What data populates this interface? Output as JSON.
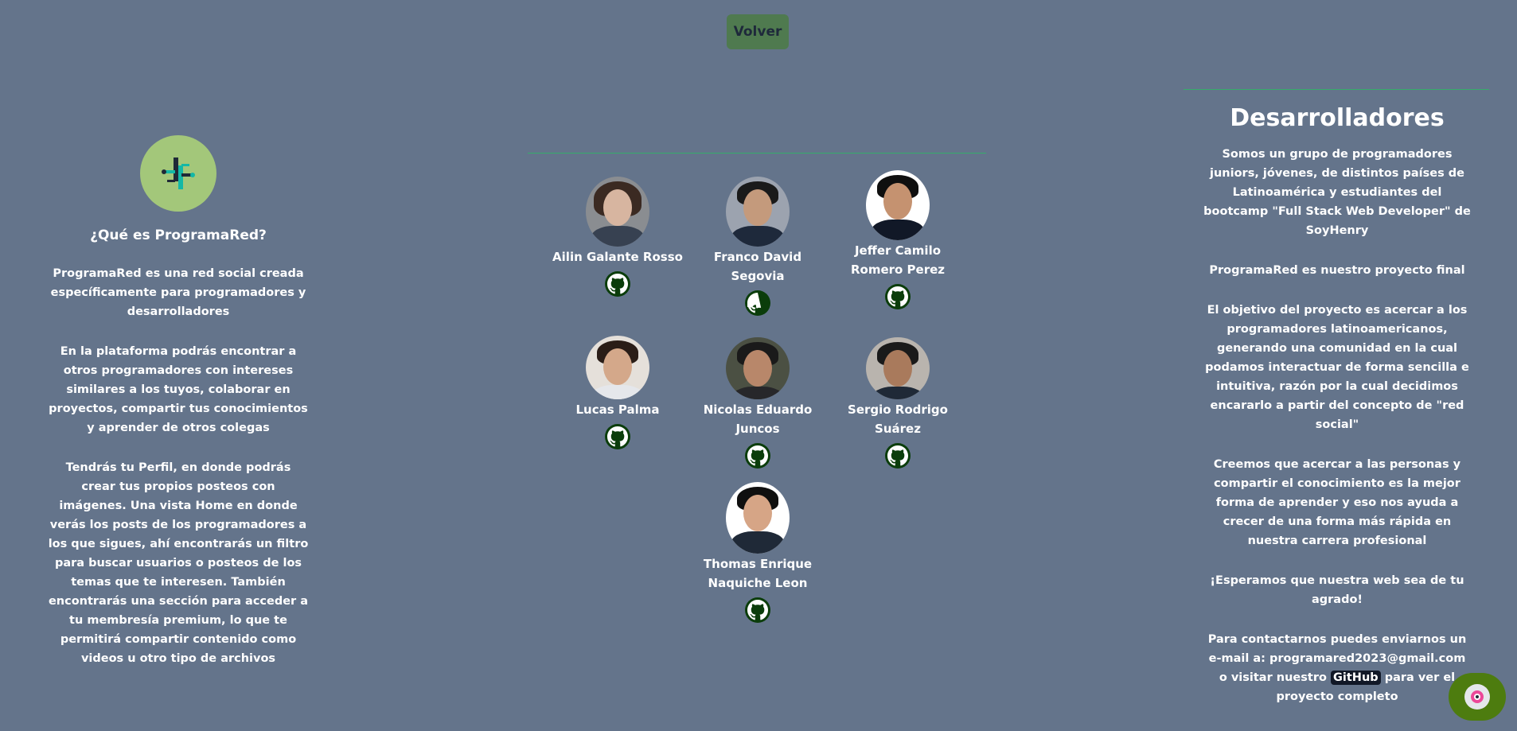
{
  "nav": {
    "back_label": "Volver"
  },
  "about": {
    "title": "¿Qué es ProgramaRed?",
    "paragraphs": [
      "ProgramaRed es una red social creada específicamente para programadores y desarrolladores",
      "En la plataforma podrás encontrar a otros programadores con intereses similares a los tuyos, colaborar en proyectos, compartir tus conocimientos y aprender de otros colegas",
      "Tendrás tu Perfil, en donde podrás crear tus propios posteos con imágenes. Una vista Home en donde verás los posts de los programadores a los que sigues, ahí encontrarás un filtro para buscar usuarios o posteos de los temas que te interesen. También encontrarás una sección para acceder a tu membresía premium, lo que te permitirá compartir contenido como videos u otro tipo de archivos"
    ]
  },
  "developers": [
    {
      "name": "Ailin Galante Rosso",
      "icon": "github-icon"
    },
    {
      "name": "Franco David Segovia",
      "icon": "github-icon"
    },
    {
      "name": "Jeffer Camilo Romero Perez",
      "icon": "github-icon"
    },
    {
      "name": "Lucas Palma",
      "icon": "github-icon"
    },
    {
      "name": "Nicolas Eduardo Juncos",
      "icon": "github-icon"
    },
    {
      "name": "Sergio Rodrigo Suárez",
      "icon": "github-icon"
    },
    {
      "name": "Thomas Enrique Naquiche Leon",
      "icon": "github-icon"
    }
  ],
  "team": {
    "title": "Desarrolladores",
    "paragraphs": [
      "Somos un grupo de programadores juniors, jóvenes, de distintos países de Latinoamérica y estudiantes del bootcamp \"Full Stack Web Developer\" de SoyHenry",
      "ProgramaRed es nuestro proyecto final",
      "El objetivo del proyecto es acercar a los programadores latinoamericanos, generando una comunidad en la cual podamos interactuar de forma sencilla e intuitiva, razón por la cual decidimos encararlo a partir del concepto de \"red social\"",
      "Creemos que acercar a las personas y compartir el conocimiento es la mejor forma de aprender y eso nos ayuda a crecer de una forma más rápida en nuestra carrera profesional",
      "¡Esperamos que nuestra web sea de tu agrado!"
    ],
    "contact_before": "Para contactarnos puedes enviarnos un e-mail a: programared2023@gmail.com o visitar nuestro ",
    "contact_link": "GitHub",
    "contact_after": " para ver el proyecto completo"
  },
  "colors": {
    "background": "#64748b",
    "accent_line": "#22c55e",
    "button": "#4f7a4f",
    "logo_bg": "#a3c77a",
    "github_bg": "#0b3d0b"
  }
}
